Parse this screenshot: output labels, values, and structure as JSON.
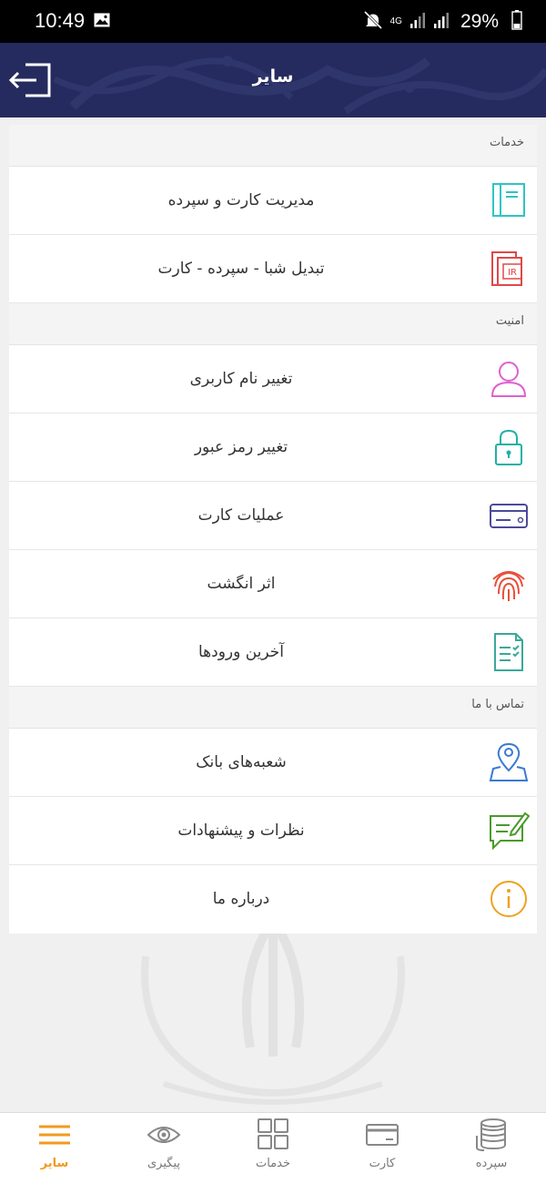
{
  "status_bar": {
    "time": "10:49",
    "network": "4G",
    "battery": "29%"
  },
  "header": {
    "title": "سایر"
  },
  "sections": [
    {
      "title": "خدمات",
      "items": [
        {
          "label": "مدیریت کارت و سپرده",
          "icon": "card-deposit-management-icon",
          "color": "#2ec4c4"
        },
        {
          "label": "تبدیل شبا - سپرده - کارت",
          "icon": "iban-convert-icon",
          "color": "#e04848"
        }
      ]
    },
    {
      "title": "امنیت",
      "items": [
        {
          "label": "تغییر نام کاربری",
          "icon": "user-icon",
          "color": "#e060d0"
        },
        {
          "label": "تغییر رمز عبور",
          "icon": "lock-icon",
          "color": "#20b0a8"
        },
        {
          "label": "عملیات کارت",
          "icon": "card-icon",
          "color": "#4a4a9a"
        },
        {
          "label": "اثر انگشت",
          "icon": "fingerprint-icon",
          "color": "#e8503a"
        },
        {
          "label": "آخرین ورودها",
          "icon": "checklist-icon",
          "color": "#3aa89a"
        }
      ]
    },
    {
      "title": "تماس با ما",
      "items": [
        {
          "label": "شعبه‌های بانک",
          "icon": "map-pin-icon",
          "color": "#3a7ad0"
        },
        {
          "label": "نظرات و پیشنهادات",
          "icon": "feedback-icon",
          "color": "#4a9a2a"
        },
        {
          "label": "درباره ما",
          "icon": "info-icon",
          "color": "#f0a020"
        }
      ]
    }
  ],
  "bottom_nav": [
    {
      "label": "سایر",
      "icon": "menu-icon",
      "active": true
    },
    {
      "label": "پیگیری",
      "icon": "eye-icon",
      "active": false
    },
    {
      "label": "خدمات",
      "icon": "grid-icon",
      "active": false
    },
    {
      "label": "کارت",
      "icon": "card-icon",
      "active": false
    },
    {
      "label": "سپرده",
      "icon": "coins-icon",
      "active": false
    }
  ],
  "colors": {
    "header_bg": "#252b5e",
    "active_tab": "#f29a1f",
    "inactive_tab": "#777777"
  }
}
